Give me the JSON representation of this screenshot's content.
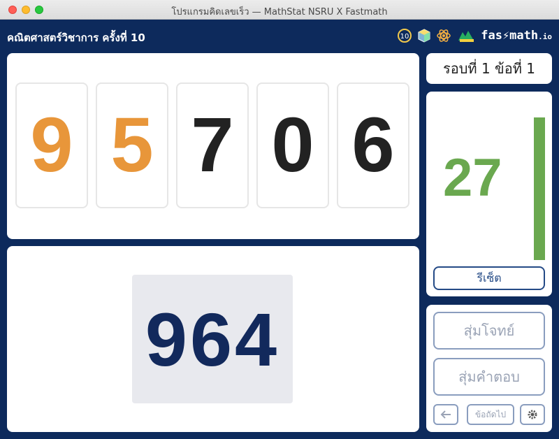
{
  "window": {
    "title": "โปรแกรมคิดเลขเร็ว — MathStat NSRU X Fastmath"
  },
  "header": {
    "title": "คณิตศาสตร์วิชาการ ครั้งที่ 10",
    "brand_main": "fas⚡math",
    "brand_suffix": ".io"
  },
  "round": {
    "label": "รอบที่ 1 ข้อที่ 1"
  },
  "digits": [
    "9",
    "5",
    "7",
    "0",
    "6"
  ],
  "target": "964",
  "timer": {
    "value": "27",
    "progress": 1.0,
    "color": "#6aa84f"
  },
  "buttons": {
    "reset": "รีเซ็ต",
    "random_question": "สุ่มโจทย์",
    "random_answer": "สุ่มคำตอบ",
    "next": "ข้อถัดไป"
  },
  "colors": {
    "accent_orange": "#e8963a",
    "navy": "#0d2a5c",
    "target_text": "#12295c"
  },
  "icons": [
    "arrow-left-icon",
    "gear-icon"
  ]
}
